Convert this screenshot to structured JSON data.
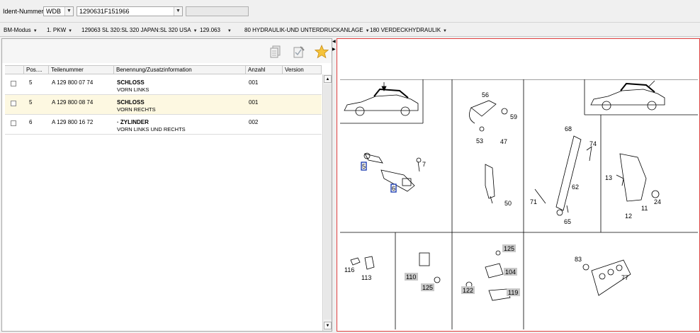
{
  "ident": {
    "label": "Ident-Nummer",
    "prefix": "WDB",
    "number": "1290631F151966"
  },
  "nav": [
    {
      "label": "BM-Modus"
    },
    {
      "label": "1. PKW"
    },
    {
      "label": "129063 SL 320:SL 320 JAPAN:SL 320 USA"
    },
    {
      "label": "129.063"
    },
    {
      "label": "80 HYDRAULIK-UND UNTERDRUCKANLAGE"
    },
    {
      "label": "180 VERDECKHYDRAULIK"
    }
  ],
  "table": {
    "headers": [
      "Pos....",
      "Teilenummer",
      "Benennung/Zusatzinformation",
      "Anzahl",
      "Version"
    ],
    "rows": [
      {
        "pos": "5",
        "part": "A 129 800 07 74",
        "name": "SCHLOSS",
        "info": "VORN LINKS",
        "qty": "001",
        "version": ""
      },
      {
        "pos": "5",
        "part": "A 129 800 08 74",
        "name": "SCHLOSS",
        "info": "VORN RECHTS",
        "qty": "001",
        "version": ""
      },
      {
        "pos": "6",
        "part": "A 129 800 16 72",
        "name": "· ZYLINDER",
        "info": "VORN LINKS UND RECHTS",
        "qty": "002",
        "version": ""
      }
    ]
  },
  "diagram": {
    "callouts": {
      "c56": "56",
      "c59": "59",
      "c53": "53",
      "c47": "47",
      "c68": "68",
      "c74": "74",
      "c62": "62",
      "c71": "71",
      "c65": "65",
      "c7": "7",
      "c50": "50",
      "c13": "13",
      "c11": "11",
      "c24": "24",
      "c12": "12",
      "c116": "116",
      "c113": "113",
      "c110": "110",
      "c125a": "125",
      "c125b": "125",
      "c104": "104",
      "c122": "122",
      "c119": "119",
      "c83": "83",
      "c77": "77",
      "b5": "5",
      "b6": "6"
    }
  }
}
